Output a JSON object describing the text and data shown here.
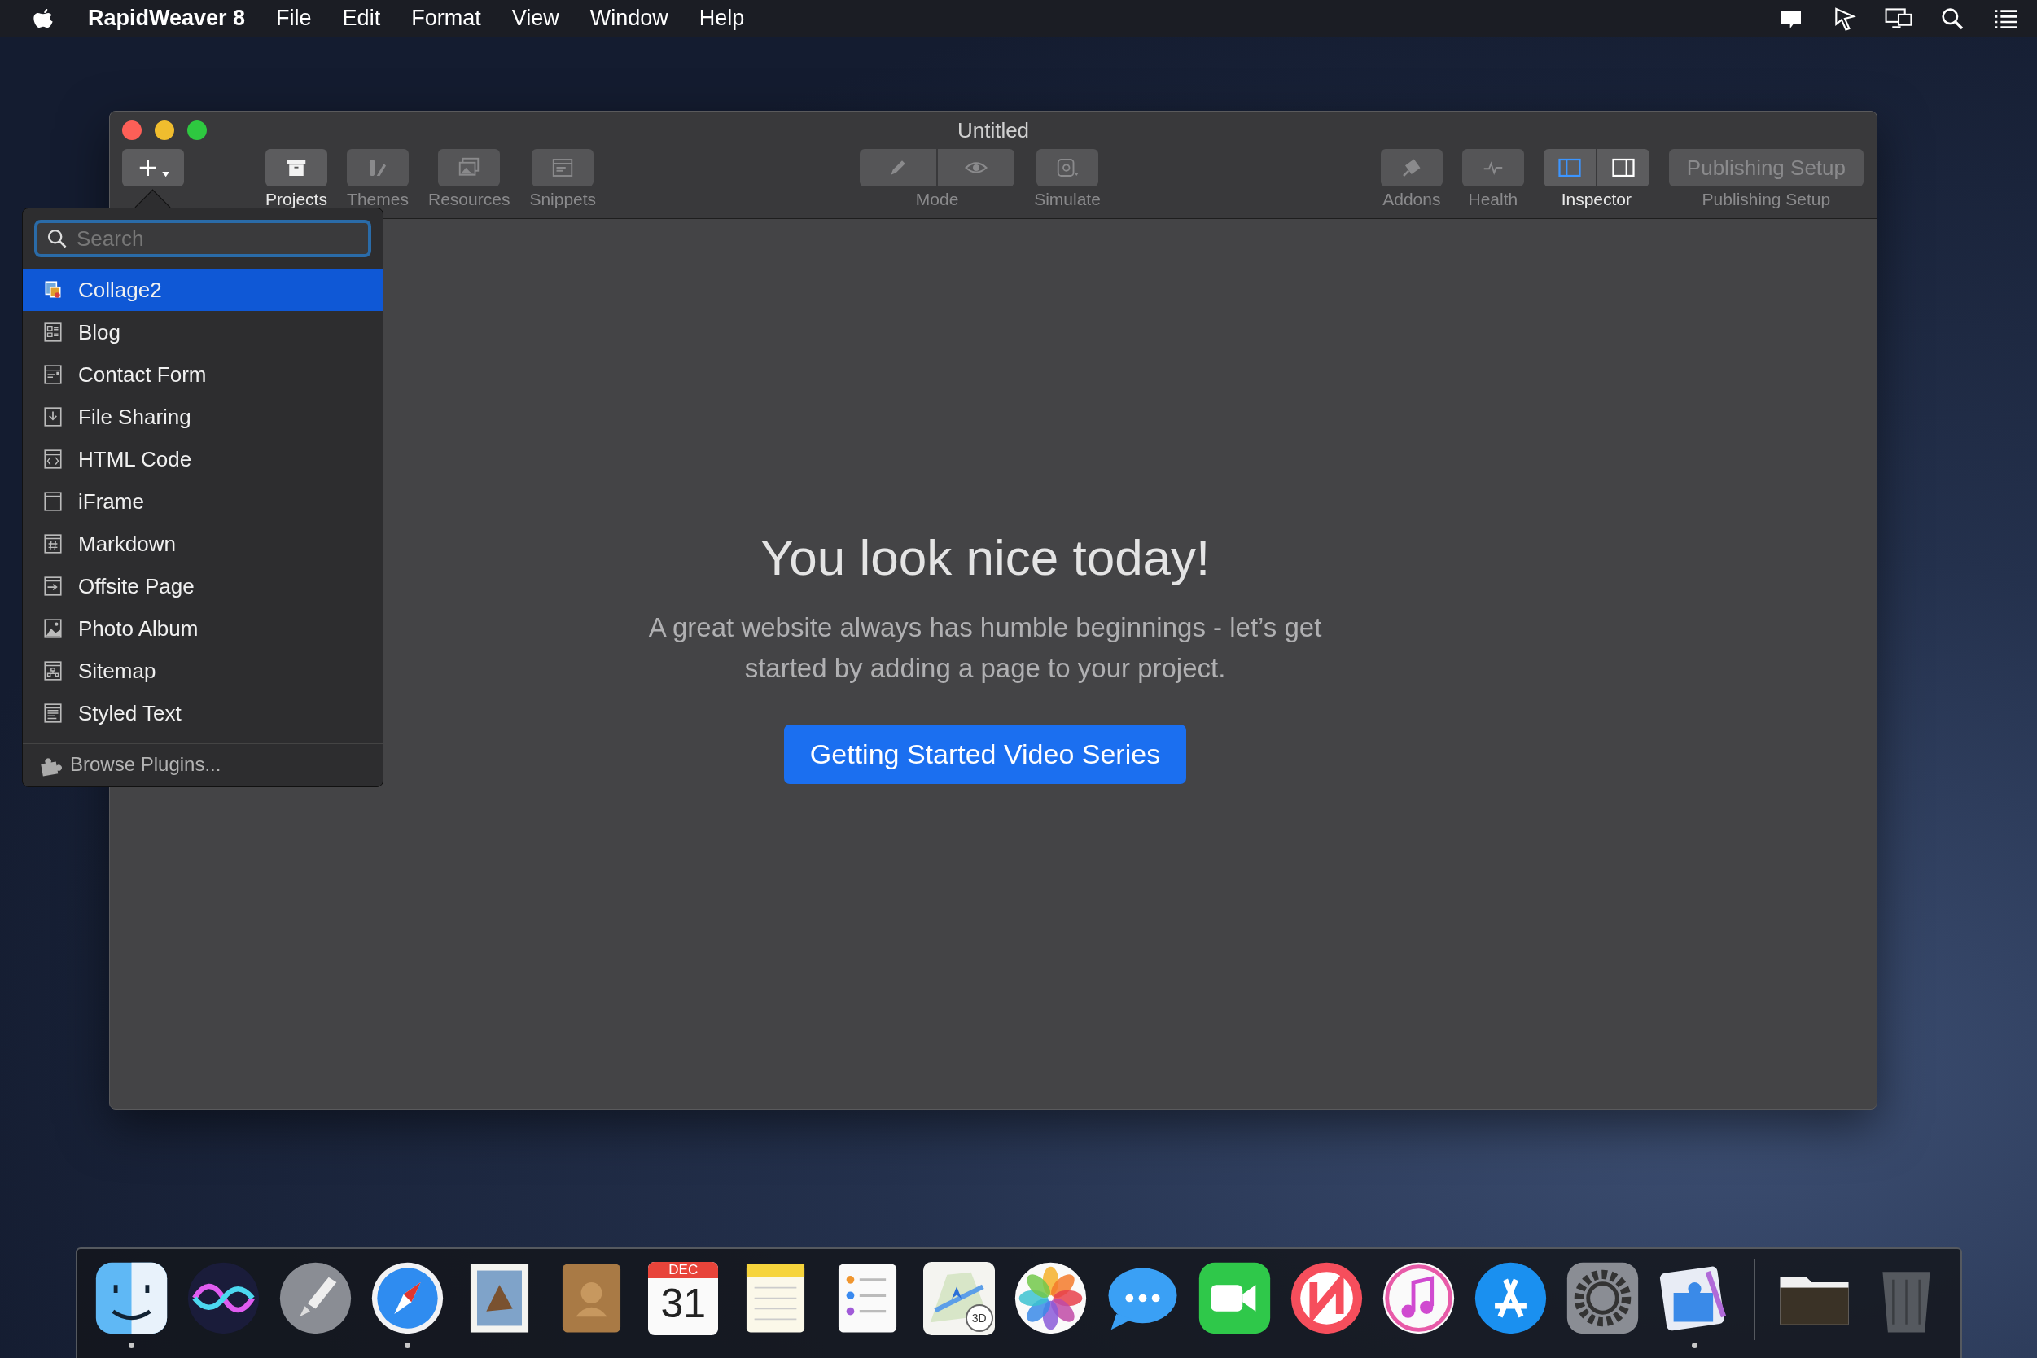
{
  "menu_bar": {
    "app_name": "RapidWeaver 8",
    "menus": [
      "File",
      "Edit",
      "Format",
      "View",
      "Window",
      "Help"
    ]
  },
  "window": {
    "title": "Untitled",
    "toolbar": [
      {
        "kind": "add"
      },
      {
        "kind": "button",
        "label": "Projects",
        "enabled": true
      },
      {
        "kind": "button",
        "label": "Themes",
        "enabled": false
      },
      {
        "kind": "button",
        "label": "Resources",
        "enabled": false
      },
      {
        "kind": "button",
        "label": "Snippets",
        "enabled": false
      },
      {
        "kind": "segmented",
        "label": "Mode",
        "enabled": false,
        "segments": [
          {
            "selected": false
          },
          {
            "selected": false
          }
        ]
      },
      {
        "kind": "button",
        "label": "Simulate",
        "enabled": false
      },
      {
        "kind": "button",
        "label": "Addons",
        "enabled": false
      },
      {
        "kind": "button",
        "label": "Health",
        "enabled": false
      },
      {
        "kind": "segmented",
        "label": "Inspector",
        "enabled": true,
        "segments": [
          {
            "selected": true
          },
          {
            "selected": false
          }
        ]
      },
      {
        "kind": "text_button",
        "text": "Publishing Setup",
        "label": "Publishing Setup",
        "enabled": false
      }
    ],
    "content": {
      "heading": "You look nice today!",
      "body": "A great website always has humble beginnings - let’s get started by adding a page to your project.",
      "button": "Getting Started Video Series"
    }
  },
  "add_page_popover": {
    "search": {
      "placeholder": "Search"
    },
    "items": [
      {
        "label": "Collage2",
        "selected": true
      },
      {
        "label": "Blog",
        "selected": false
      },
      {
        "label": "Contact Form",
        "selected": false
      },
      {
        "label": "File Sharing",
        "selected": false
      },
      {
        "label": "HTML Code",
        "selected": false
      },
      {
        "label": "iFrame",
        "selected": false
      },
      {
        "label": "Markdown",
        "selected": false
      },
      {
        "label": "Offsite Page",
        "selected": false
      },
      {
        "label": "Photo Album",
        "selected": false
      },
      {
        "label": "Sitemap",
        "selected": false
      },
      {
        "label": "Styled Text",
        "selected": false
      }
    ],
    "footer": "Browse Plugins..."
  },
  "dock": [
    {
      "kind": "app",
      "running": true
    },
    {
      "kind": "app",
      "running": false
    },
    {
      "kind": "app",
      "running": false
    },
    {
      "kind": "app",
      "running": true
    },
    {
      "kind": "app",
      "running": false
    },
    {
      "kind": "app",
      "running": false
    },
    {
      "kind": "calendar",
      "running": false,
      "month": "DEC",
      "day": "31"
    },
    {
      "kind": "app",
      "running": false
    },
    {
      "kind": "app",
      "running": false
    },
    {
      "kind": "maps",
      "running": false,
      "badge": "3D"
    },
    {
      "kind": "app",
      "running": false
    },
    {
      "kind": "app",
      "running": false
    },
    {
      "kind": "app",
      "running": false
    },
    {
      "kind": "app",
      "running": false
    },
    {
      "kind": "app",
      "running": false
    },
    {
      "kind": "app",
      "running": false
    },
    {
      "kind": "app",
      "running": false
    },
    {
      "kind": "app",
      "running": true
    },
    {
      "kind": "separator"
    },
    {
      "kind": "app",
      "running": false
    },
    {
      "kind": "app",
      "running": false
    }
  ]
}
